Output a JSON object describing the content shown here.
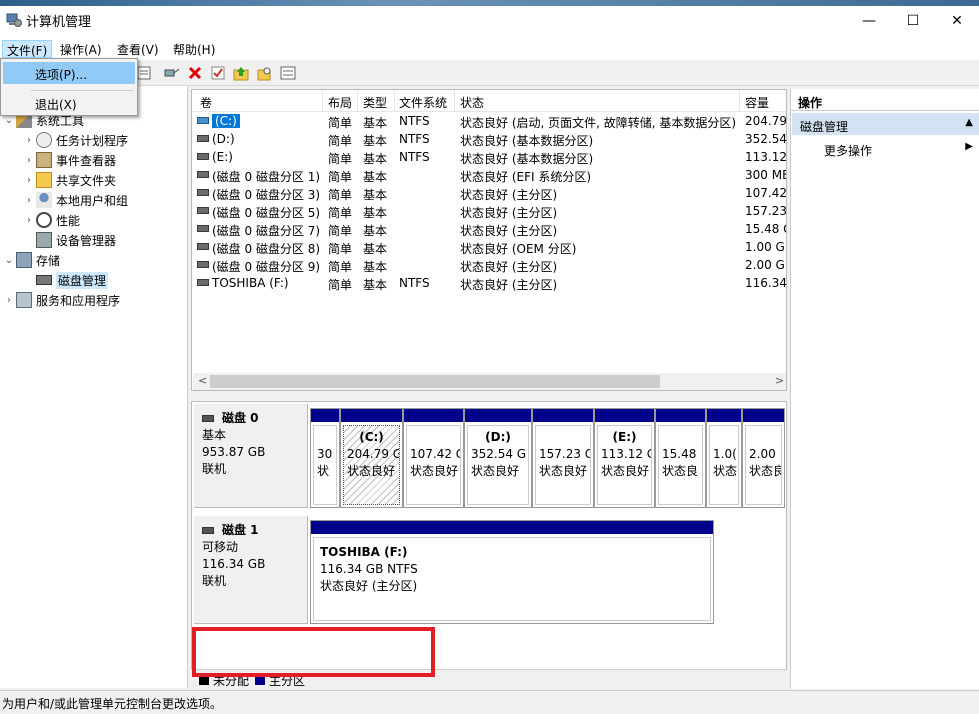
{
  "window": {
    "title": "计算机管理"
  },
  "window_buttons": {
    "min": "—",
    "max": "☐",
    "close": "✕"
  },
  "menubar": [
    "文件(F)",
    "操作(A)",
    "查看(V)",
    "帮助(H)"
  ],
  "file_menu": {
    "options": "选项(P)...",
    "exit": "退出(X)"
  },
  "toolbar": {
    "icons": [
      "properties-icon",
      "connect-icon",
      "delete-icon",
      "check-icon",
      "up-folder-icon",
      "search-folder-icon",
      "list-icon"
    ]
  },
  "tree": [
    {
      "label": "系统工具",
      "arrow": "⌄",
      "icon": "tools-icon"
    },
    {
      "label": "任务计划程序",
      "arrow": "›",
      "icon": "clock-icon"
    },
    {
      "label": "事件查看器",
      "arrow": "›",
      "icon": "event-viewer-icon"
    },
    {
      "label": "共享文件夹",
      "arrow": "›",
      "icon": "shared-folder-icon"
    },
    {
      "label": "本地用户和组",
      "arrow": "›",
      "icon": "users-icon"
    },
    {
      "label": "性能",
      "arrow": "›",
      "icon": "performance-icon"
    },
    {
      "label": "设备管理器",
      "arrow": "",
      "icon": "device-manager-icon"
    },
    {
      "label": "存储",
      "arrow": "⌄",
      "icon": "storage-icon"
    },
    {
      "label": "磁盘管理",
      "arrow": "",
      "icon": "disk-management-icon"
    },
    {
      "label": "服务和应用程序",
      "arrow": "›",
      "icon": "services-icon"
    }
  ],
  "volume_table": {
    "headers": [
      "卷",
      "布局",
      "类型",
      "文件系统",
      "状态",
      "容量"
    ],
    "rows": [
      {
        "vol": "(C:)",
        "layout": "简单",
        "type": "基本",
        "fs": "NTFS",
        "status": "状态良好 (启动, 页面文件, 故障转储, 基本数据分区)",
        "cap": "204.79"
      },
      {
        "vol": "(D:)",
        "layout": "简单",
        "type": "基本",
        "fs": "NTFS",
        "status": "状态良好 (基本数据分区)",
        "cap": "352.54"
      },
      {
        "vol": "(E:)",
        "layout": "简单",
        "type": "基本",
        "fs": "NTFS",
        "status": "状态良好 (基本数据分区)",
        "cap": "113.12"
      },
      {
        "vol": "(磁盘 0 磁盘分区 1)",
        "layout": "简单",
        "type": "基本",
        "fs": "",
        "status": "状态良好 (EFI 系统分区)",
        "cap": "300 ME"
      },
      {
        "vol": "(磁盘 0 磁盘分区 3)",
        "layout": "简单",
        "type": "基本",
        "fs": "",
        "status": "状态良好 (主分区)",
        "cap": "107.42"
      },
      {
        "vol": "(磁盘 0 磁盘分区 5)",
        "layout": "简单",
        "type": "基本",
        "fs": "",
        "status": "状态良好 (主分区)",
        "cap": "157.23"
      },
      {
        "vol": "(磁盘 0 磁盘分区 7)",
        "layout": "简单",
        "type": "基本",
        "fs": "",
        "status": "状态良好 (主分区)",
        "cap": "15.48 G"
      },
      {
        "vol": "(磁盘 0 磁盘分区 8)",
        "layout": "简单",
        "type": "基本",
        "fs": "",
        "status": "状态良好 (OEM 分区)",
        "cap": "1.00 GE"
      },
      {
        "vol": "(磁盘 0 磁盘分区 9)",
        "layout": "简单",
        "type": "基本",
        "fs": "",
        "status": "状态良好 (主分区)",
        "cap": "2.00 GE"
      },
      {
        "vol": "TOSHIBA (F:)",
        "layout": "简单",
        "type": "基本",
        "fs": "NTFS",
        "status": "状态良好 (主分区)",
        "cap": "116.34"
      }
    ]
  },
  "scroll": {
    "left": "<",
    "right": ">"
  },
  "disks": [
    {
      "name": "磁盘 0",
      "kind": "基本",
      "size": "953.87 GB",
      "state": "联机"
    },
    {
      "name": "磁盘 1",
      "kind": "可移动",
      "size": "116.34 GB",
      "state": "联机"
    }
  ],
  "disk0_partitions": [
    {
      "name": "",
      "size": "30",
      "status": "状"
    },
    {
      "name": "(C:)",
      "size": "204.79 G",
      "status": "状态良好"
    },
    {
      "name": "",
      "size": "107.42 G",
      "status": "状态良好"
    },
    {
      "name": "(D:)",
      "size": "352.54 G",
      "status": "状态良好"
    },
    {
      "name": "",
      "size": "157.23 G",
      "status": "状态良好"
    },
    {
      "name": "(E:)",
      "size": "113.12 G",
      "status": "状态良好"
    },
    {
      "name": "",
      "size": "15.48",
      "status": "状态良"
    },
    {
      "name": "",
      "size": "1.0(",
      "status": "状态"
    },
    {
      "name": "",
      "size": "2.00",
      "status": "状态良"
    }
  ],
  "disk1_partition": {
    "name": "TOSHIBA  (F:)",
    "size": "116.34 GB NTFS",
    "status": "状态良好 (主分区)"
  },
  "legend": {
    "unallocated": "未分配",
    "primary": "主分区",
    "unallocated_color": "#000000",
    "primary_color": "#00008b"
  },
  "actions": {
    "title": "操作",
    "section": "磁盘管理",
    "more": "更多操作",
    "section_caret": "▲",
    "more_caret": "▶"
  },
  "statusbar": {
    "text": "为用户和/或此管理单元控制台更改选项。"
  }
}
